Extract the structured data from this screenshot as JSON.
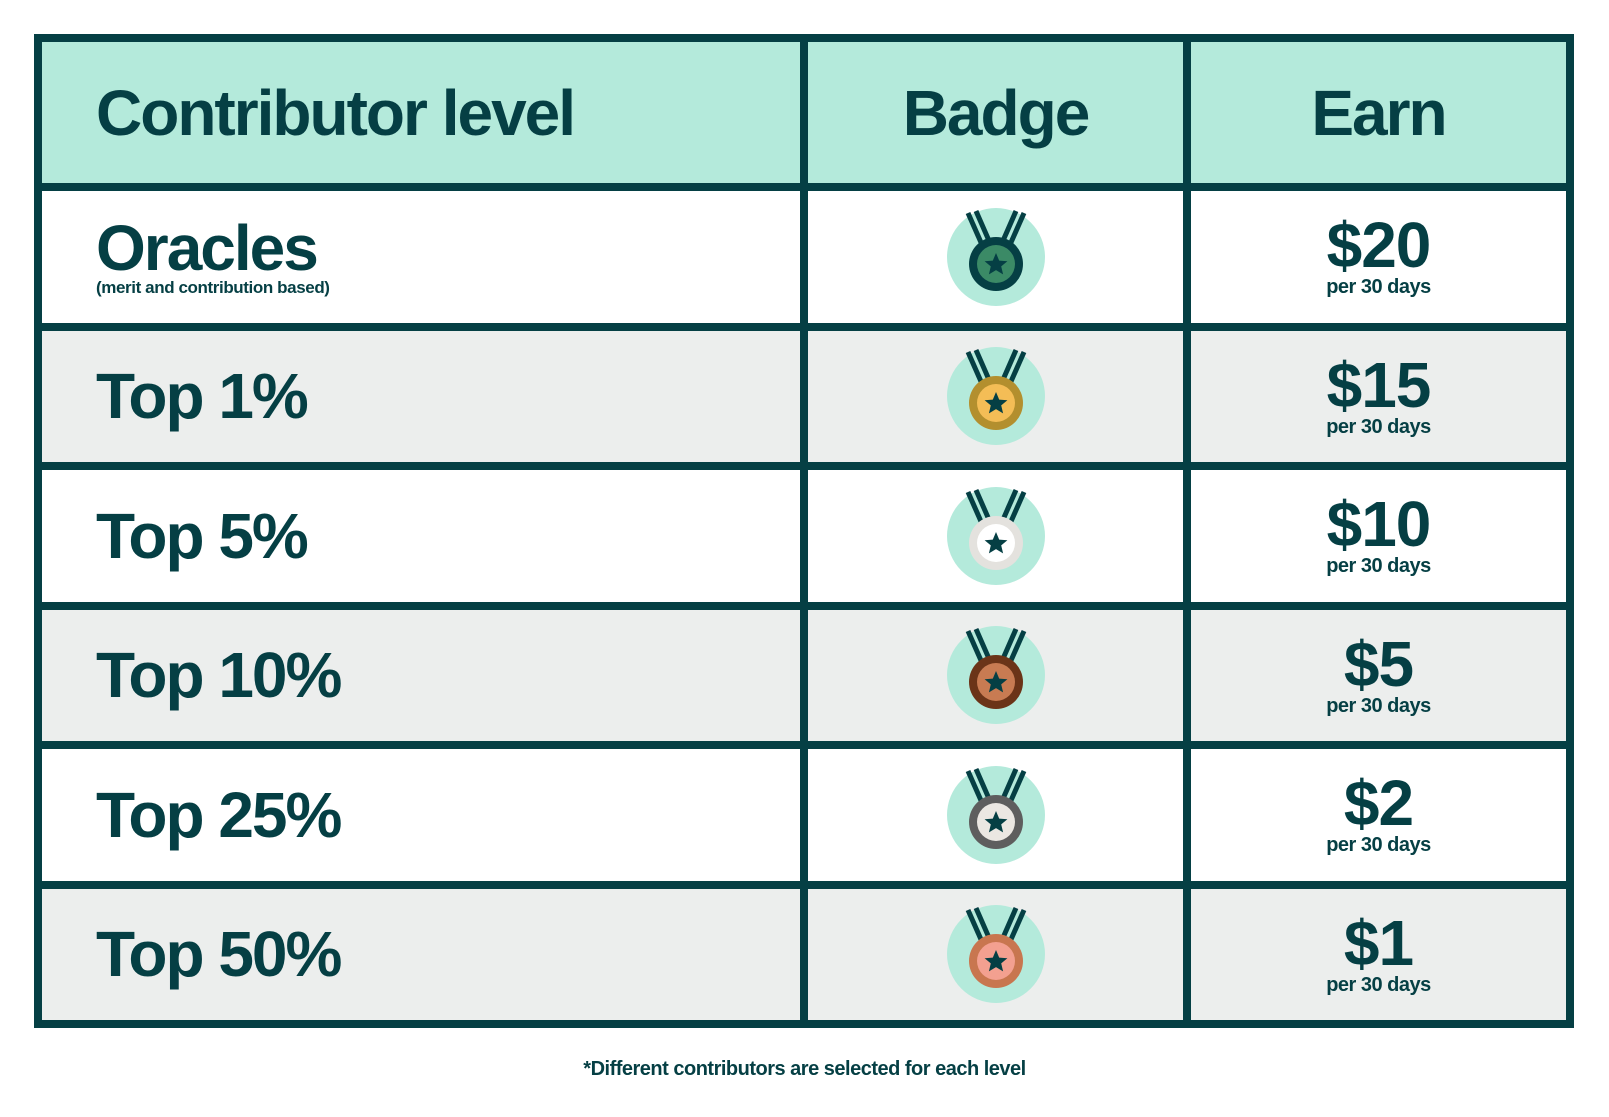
{
  "headers": {
    "level": "Contributor level",
    "badge": "Badge",
    "earn": "Earn"
  },
  "rows": [
    {
      "level": "Oracles",
      "sublabel": "(merit and contribution based)",
      "badge": "oracle-medal-icon",
      "amount": "$20",
      "period": "per 30 days",
      "medal_colors": {
        "ring": "#053f44",
        "face": "#3b8a66"
      }
    },
    {
      "level": "Top 1%",
      "sublabel": "",
      "badge": "gold-medal-icon",
      "amount": "$15",
      "period": "per 30 days",
      "medal_colors": {
        "ring": "#b38f2e",
        "face": "#f4bd56"
      }
    },
    {
      "level": "Top 5%",
      "sublabel": "",
      "badge": "silver-medal-icon",
      "amount": "$10",
      "period": "per 30 days",
      "medal_colors": {
        "ring": "#e4e2de",
        "face": "#ffffff"
      }
    },
    {
      "level": "Top 10%",
      "sublabel": "",
      "badge": "bronze-medal-icon",
      "amount": "$5",
      "period": "per 30 days",
      "medal_colors": {
        "ring": "#6b3418",
        "face": "#c87b52"
      }
    },
    {
      "level": "Top 25%",
      "sublabel": "",
      "badge": "gray-medal-icon",
      "amount": "$2",
      "period": "per 30 days",
      "medal_colors": {
        "ring": "#5e5e5e",
        "face": "#ebe7e2"
      }
    },
    {
      "level": "Top 50%",
      "sublabel": "",
      "badge": "rose-medal-icon",
      "amount": "$1",
      "period": "per 30 days",
      "medal_colors": {
        "ring": "#c8764f",
        "face": "#f3a090"
      }
    }
  ],
  "colors": {
    "border": "#053f44",
    "header_bg": "#b4eadb",
    "badge_circle": "#b4eadb",
    "row_alt_bg": "#eceeed"
  },
  "footnote": "*Different contributors are selected for each level"
}
